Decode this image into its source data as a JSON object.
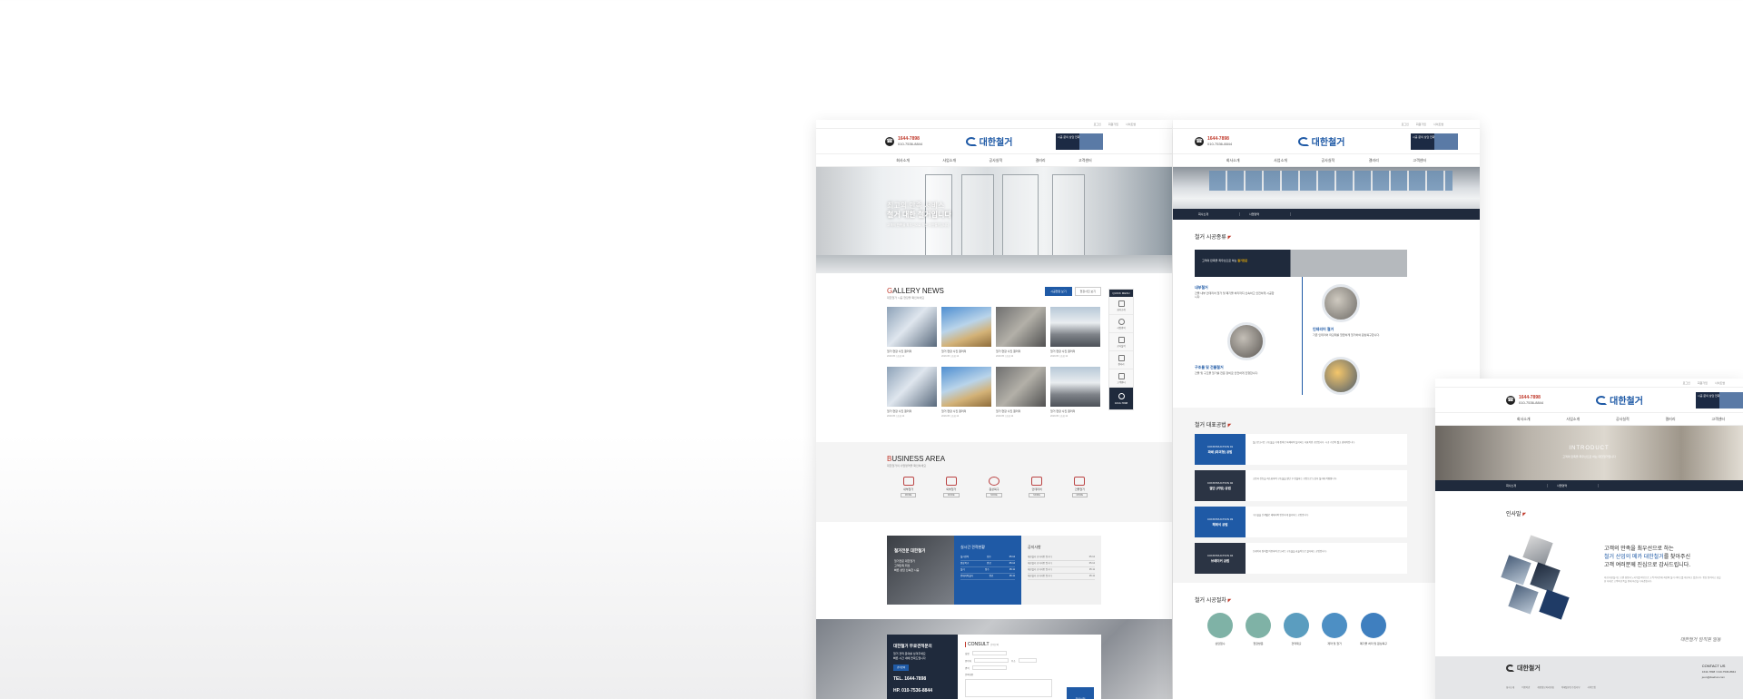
{
  "site": {
    "phone": "1644-7898",
    "phone_sub": "010-7536-8844",
    "logo": "대한철거",
    "util_links": [
      "로그인",
      "회원가입",
      "사이트맵"
    ],
    "banner_text": "시공 문의 상담 전화",
    "nav": [
      "회사소개",
      "사업소개",
      "공사실적",
      "갤러리",
      "고객센터"
    ]
  },
  "page1": {
    "hero_line1": "최고의 만족 서비스",
    "hero_line2": "철거 대한 철거입니다",
    "hero_sub": "고객의 만족을 최우선으로 하는 대한철거입니다",
    "gallery_title_initial": "G",
    "gallery_title_rest": "ALLERY NEWS",
    "gallery_sub": "대한철거 시공 현장을 확인하세요",
    "gallery_btn1": "시공현장 보기",
    "gallery_btn2": "현장사진 보기",
    "gallery_items": [
      {
        "caption": "철거 현장 사진 갤러리",
        "meta": "2019.05 | 조회 12"
      },
      {
        "caption": "철거 현장 사진 갤러리",
        "meta": "2019.05 | 조회 12"
      },
      {
        "caption": "철거 현장 사진 갤러리",
        "meta": "2019.05 | 조회 12"
      },
      {
        "caption": "철거 현장 사진 갤러리",
        "meta": "2019.05 | 조회 12"
      },
      {
        "caption": "철거 현장 사진 갤러리",
        "meta": "2019.05 | 조회 12"
      },
      {
        "caption": "철거 현장 사진 갤러리",
        "meta": "2019.05 | 조회 12"
      },
      {
        "caption": "철거 현장 사진 갤러리",
        "meta": "2019.05 | 조회 12"
      },
      {
        "caption": "철거 현장 사진 갤러리",
        "meta": "2019.05 | 조회 12"
      }
    ],
    "quick_title": "QUICK MENU",
    "quick_items": [
      "회사소개",
      "사업영역",
      "공사실적",
      "갤러리",
      "고객센터"
    ],
    "quick_call": "1644-7898",
    "biz_title_initial": "B",
    "biz_title_rest": "USINESS AREA",
    "biz_sub": "대한철거의 사업영역을 확인하세요",
    "biz_items": [
      "내부철거",
      "외부철거",
      "원상복구",
      "인테리어",
      "건물철거"
    ],
    "biz_more": "MORE",
    "board_promo_title": "철거전문 대한철거",
    "board_promo_lines": [
      "철거전문 대한철거",
      "고객만족 최선",
      "빠른 상담 신속한 시공"
    ],
    "board_live_title": "실시간 견적현황",
    "board_live_rows": [
      {
        "name": "철거견적",
        "status": "접수",
        "date": "05.12"
      },
      {
        "name": "원상복구",
        "status": "완료",
        "date": "05.12"
      },
      {
        "name": "철거",
        "status": "접수",
        "date": "05.11"
      },
      {
        "name": "인테리어철거",
        "status": "완료",
        "date": "05.11"
      }
    ],
    "board_notice_title": "공지사항",
    "board_notice_rows": [
      {
        "name": "대한철거 공지사항 입니다",
        "date": "05.12"
      },
      {
        "name": "대한철거 공지사항 입니다",
        "date": "05.12"
      },
      {
        "name": "대한철거 공지사항 입니다",
        "date": "05.11"
      },
      {
        "name": "대한철거 공지사항 입니다",
        "date": "05.11"
      }
    ],
    "consult_left_title": "대한철거 무료견적문의",
    "consult_left_lines": [
      "철거 견적 문의를 남겨주세요",
      "빠른 시간 내에 연락드립니다"
    ],
    "consult_tag": "견적문의",
    "consult_tel": "TEL. 1644-7898",
    "consult_hp": "HP. 010-7536-8844",
    "consult_title": "CONSULT",
    "consult_title_sub": "견적문의",
    "consult_fields": [
      "성명",
      "연락처",
      "주소",
      "면적"
    ],
    "consult_msg_label": "문의내용",
    "consult_submit": "문의신청"
  },
  "page2": {
    "subnav": [
      "회사소개",
      "사업영역"
    ],
    "sec1_title": "철거 시공종류",
    "dark_bar_text": "고객의 만족을 최우선으로 하는",
    "dark_bar_highlight": "철거전문",
    "proc": [
      {
        "title": "내부철거",
        "text": "건물 내부 인테리어 철거 및 폐기물 처리까지 신속하고 안전하게 시공합니다."
      },
      {
        "title": "인테리어 철거",
        "text": "기존 인테리어 마감재를 깔끔하게 철거하여 원상복구합니다."
      },
      {
        "title": "구조물 및 건물철거",
        "text": "건물 및 구조물 철거를 전문 장비로 안전하게 진행합니다."
      }
    ],
    "sec2_title": "철거 대표공법",
    "methods": [
      {
        "tag": "CONSTRUCTION 01",
        "name": "파쇄 (파괴형) 공법",
        "text": "철근콘크리트 구조물을 기계 장비로 파쇄하여 철거하는 대표적인 공법입니다. 시공 기간이 짧고 경제적입니다."
      },
      {
        "tag": "CONSTRUCTION 02",
        "name": "절단 (커팅) 공법",
        "text": "소음과 진동을 최소화하여 구조물을 절단 후 반출하는 공법으로 도심지 철거에 적합합니다."
      },
      {
        "tag": "CONSTRUCTION 03",
        "name": "해체식 공법",
        "text": "구조물을 단계별로 해체하여 안전하게 철거하는 공법입니다."
      },
      {
        "tag": "CONSTRUCTION 04",
        "name": "브레이커 공법",
        "text": "브레이커 장비를 이용하여 콘크리트 구조물을 효율적으로 철거하는 공법입니다."
      }
    ],
    "sec3_title": "철거 시공절차",
    "tools": [
      "상담접수",
      "현장방문",
      "견적제출",
      "계약 및 철거",
      "폐기물 처리 및 원상복구"
    ]
  },
  "page3": {
    "hero_title": "INTRODUCT",
    "hero_sub": "고객의 만족을 최우선으로 하는 대한철거입니다",
    "title": "인사말",
    "text_line1": "고객의 만족을 최우선으로 하는",
    "text_line2_blue": "철거 산업의 메카 대한철거",
    "text_line2_rest": "를 찾아주신",
    "text_line3": "고객 여러분께 진심으로 감사드립니다.",
    "paragraph": "저희 대한철거는 오랜 경험과 노하우를 바탕으로 고객 여러분께 최상의 철거 서비스를 제공하고 있습니다. 항상 정직하고 성실한 자세로 고객의 만족을 위해 최선을 다하겠습니다.",
    "signature": "대한철거 임직원 일동",
    "footer_links": [
      "회사소개",
      "이용약관",
      "개인정보처리방침",
      "이메일무단수집거부",
      "사이트맵"
    ],
    "contact_title": "CONTACT US",
    "contact_phone": "1644-7898 / 010-7536-8844",
    "contact_email": "jeon@daehan.com"
  }
}
